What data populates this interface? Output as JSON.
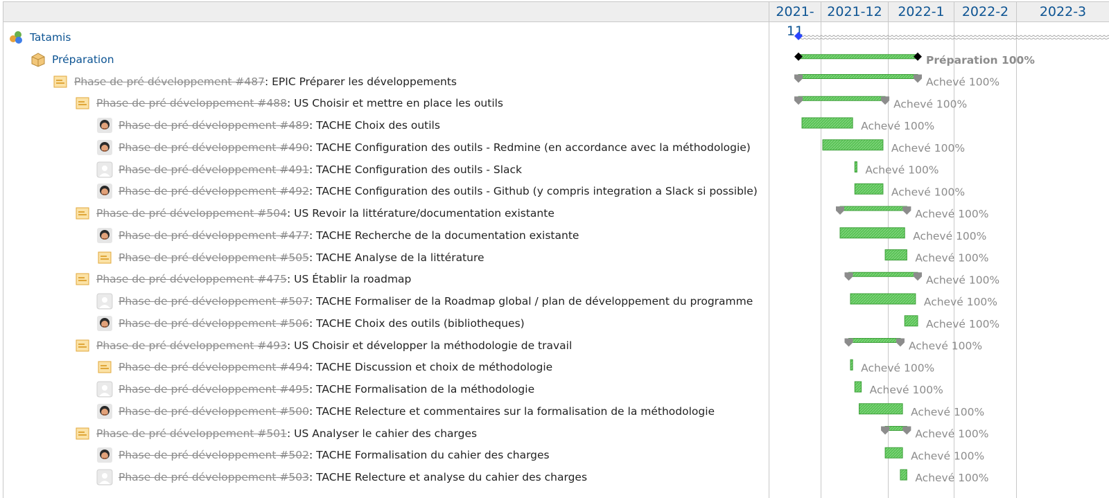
{
  "months": [
    "2021-11",
    "2021-12",
    "2022-1",
    "2022-2",
    "2022-3"
  ],
  "colors": {
    "link": "#0d5493",
    "closed": "#8c8c8c",
    "bar_done": "#59c255",
    "bar_done_dark": "#3e9f3a",
    "milestone": "#2a44ff",
    "parent_marker": "#8c8c8c"
  },
  "rows": [
    {
      "kind": "project",
      "icon": "projects-icon",
      "label": "Tatamis",
      "bar": {
        "type": "project",
        "start": "2021-11-01",
        "end": "2022-03-31"
      }
    },
    {
      "kind": "version",
      "icon": "package-icon",
      "label": "Préparation",
      "bar": {
        "type": "version",
        "start": "2021-11-01",
        "end": "2022-01-01",
        "label": "Préparation 100%"
      }
    },
    {
      "kind": "issue",
      "icon": "task-parent-icon",
      "ref": "Phase de pré développement #487",
      "title": "EPIC Préparer les développements",
      "bar": {
        "type": "parent",
        "start": "2021-11-01",
        "end": "2022-01-01",
        "label": "Achevé 100%"
      }
    },
    {
      "kind": "issue",
      "icon": "task-parent-icon",
      "ref": "Phase de pré développement #488",
      "title": "US Choisir et mettre en place les outils",
      "bar": {
        "type": "parent",
        "start": "2021-11-01",
        "end": "2021-12-17",
        "label": "Achevé 100%"
      }
    },
    {
      "kind": "issue",
      "icon": "user-avatar-icon",
      "ref": "Phase de pré développement #489",
      "title": "TACHE Choix des outils",
      "bar": {
        "type": "task",
        "start": "2021-11-03",
        "end": "2021-12-02",
        "label": "Achevé 100%"
      }
    },
    {
      "kind": "issue",
      "icon": "user-avatar-icon",
      "ref": "Phase de pré développement #490",
      "title": "TACHE Configuration des outils - Redmine (en accordance avec la méthodologie)",
      "bar": {
        "type": "task",
        "start": "2021-11-15",
        "end": "2021-12-16",
        "label": "Achevé 100%"
      }
    },
    {
      "kind": "issue",
      "icon": "blank-avatar-icon",
      "ref": "Phase de pré développement #491",
      "title": "TACHE Configuration des outils - Slack",
      "bar": {
        "type": "task",
        "start": "2021-12-03",
        "end": "2021-12-04",
        "label": "Achevé 100%"
      }
    },
    {
      "kind": "issue",
      "icon": "user-avatar-icon",
      "ref": "Phase de pré développement #492",
      "title": "TACHE Configuration des outils - Github (y compris integration a Slack si possible)",
      "bar": {
        "type": "task",
        "start": "2021-12-03",
        "end": "2021-12-16",
        "label": "Achevé 100%"
      }
    },
    {
      "kind": "issue",
      "icon": "task-parent-icon",
      "ref": "Phase de pré développement #504",
      "title": "US Revoir la littérature/documentation existante",
      "bar": {
        "type": "parent",
        "start": "2021-11-25",
        "end": "2021-12-27",
        "label": "Achevé 100%"
      }
    },
    {
      "kind": "issue",
      "icon": "user-avatar-icon",
      "ref": "Phase de pré développement #477",
      "title": "TACHE Recherche de la documentation existante",
      "bar": {
        "type": "task",
        "start": "2021-11-25",
        "end": "2021-12-26",
        "label": "Achevé 100%"
      }
    },
    {
      "kind": "issue",
      "icon": "task-icon",
      "ref": "Phase de pré développement #505",
      "title": "TACHE Analyse de la littérature",
      "bar": {
        "type": "task",
        "start": "2021-12-17",
        "end": "2021-12-27",
        "label": "Achevé 100%"
      }
    },
    {
      "kind": "issue",
      "icon": "task-parent-icon",
      "ref": "Phase de pré développement #475",
      "title": "US Établir la roadmap",
      "bar": {
        "type": "parent",
        "start": "2021-11-30",
        "end": "2022-01-01",
        "label": "Achevé 100%"
      }
    },
    {
      "kind": "issue",
      "icon": "blank-avatar-icon",
      "ref": "Phase de pré développement #507",
      "title": "TACHE Formaliser de la Roadmap global / plan de développement du programme",
      "bar": {
        "type": "task",
        "start": "2021-12-01",
        "end": "2021-12-31",
        "label": "Achevé 100%"
      }
    },
    {
      "kind": "issue",
      "icon": "user-avatar-icon",
      "ref": "Phase de pré développement #506",
      "title": "TACHE Choix des outils (bibliotheques)",
      "bar": {
        "type": "task",
        "start": "2021-12-26",
        "end": "2022-01-01",
        "label": "Achevé 100%"
      }
    },
    {
      "kind": "issue",
      "icon": "task-parent-icon",
      "ref": "Phase de pré développement #493",
      "title": "US Choisir et développer la méthodologie de travail",
      "bar": {
        "type": "parent",
        "start": "2021-11-30",
        "end": "2021-12-24",
        "label": "Achevé 100%"
      }
    },
    {
      "kind": "issue",
      "icon": "task-icon",
      "ref": "Phase de pré développement #494",
      "title": "TACHE Discussion et choix de méthodologie",
      "bar": {
        "type": "task",
        "start": "2021-12-01",
        "end": "2021-12-02",
        "label": "Achevé 100%"
      }
    },
    {
      "kind": "issue",
      "icon": "blank-avatar-icon",
      "ref": "Phase de pré développement #495",
      "title": "TACHE Formalisation de la méthodologie",
      "bar": {
        "type": "task",
        "start": "2021-12-03",
        "end": "2021-12-06",
        "label": "Achevé 100%"
      }
    },
    {
      "kind": "issue",
      "icon": "user-avatar-icon",
      "ref": "Phase de pré développement #500",
      "title": "TACHE Relecture et commentaires sur la formalisation de la méthodologie",
      "bar": {
        "type": "task",
        "start": "2021-12-05",
        "end": "2021-12-25",
        "label": "Achevé 100%"
      }
    },
    {
      "kind": "issue",
      "icon": "task-parent-icon",
      "ref": "Phase de pré développement #501",
      "title": "US Analyser le cahier des charges",
      "bar": {
        "type": "parent",
        "start": "2021-12-17",
        "end": "2021-12-27",
        "label": "Achevé 100%"
      }
    },
    {
      "kind": "issue",
      "icon": "user-avatar-icon",
      "ref": "Phase de pré développement #502",
      "title": "TACHE Formalisation du cahier des charges",
      "bar": {
        "type": "task",
        "start": "2021-12-17",
        "end": "2021-12-25",
        "label": "Achevé 100%"
      }
    },
    {
      "kind": "issue",
      "icon": "blank-avatar-icon",
      "ref": "Phase de pré développement #503",
      "title": "TACHE Relecture et analyse du cahier des charges",
      "bar": {
        "type": "task",
        "start": "2021-12-24",
        "end": "2021-12-27",
        "label": "Achevé 100%"
      }
    }
  ]
}
